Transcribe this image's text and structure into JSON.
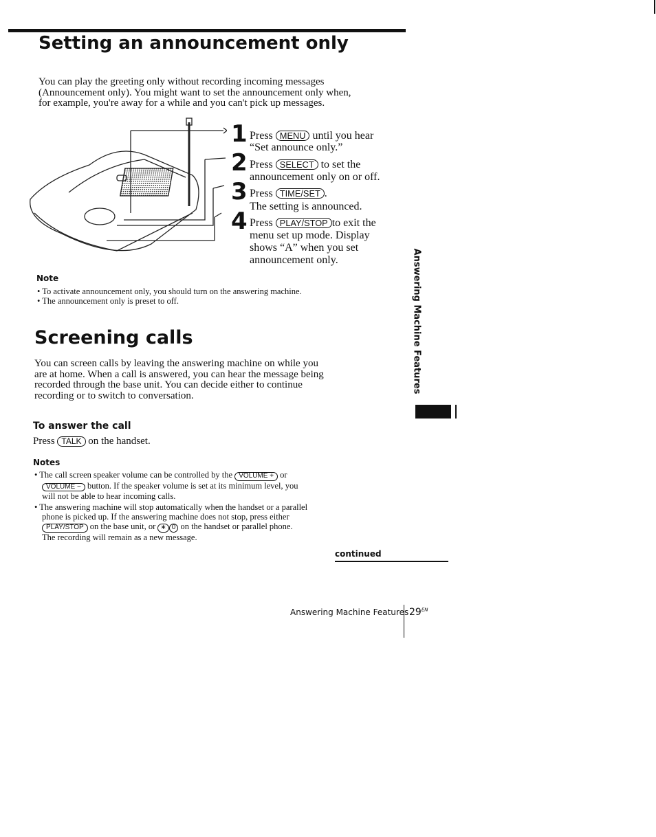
{
  "section1": {
    "title": "Setting an announcement only",
    "intro": [
      "You can play the greeting only without recording incoming messages",
      "(Announcement only). You might want to set the announcement only when,",
      "for example, you're away for a while and you can't pick up messages."
    ],
    "steps": [
      {
        "num": "1",
        "pre": "Press",
        "key": "MENU",
        "post": "until you hear",
        "lines": [
          "“Set announce only.”"
        ]
      },
      {
        "num": "2",
        "pre": "Press",
        "key": "SELECT",
        "post": "to set the",
        "lines": [
          "announcement only on or off."
        ]
      },
      {
        "num": "3",
        "pre": "Press",
        "key": "TIME/SET",
        "post": ".",
        "lines": [
          "The setting is announced."
        ]
      },
      {
        "num": "4",
        "pre": "Press",
        "key": "PLAY/STOP",
        "post": "to exit the",
        "lines": [
          "menu set up mode. Display",
          "shows “A” when you set",
          "announcement only."
        ]
      }
    ],
    "note_title": "Note",
    "notes": [
      "To activate announcement only, you should turn on the answering machine.",
      "The announcement only is preset to off."
    ]
  },
  "section2": {
    "title": "Screening calls",
    "intro": [
      "You can screen calls by leaving the answering machine on while you",
      "are at home. When a call is answered, you can hear the message being",
      "recorded through the base unit. You can decide either to continue",
      "recording or to switch to conversation."
    ],
    "sub_title": "To answer the call",
    "answer": {
      "pre": "Press",
      "key": "TALK",
      "post": "on the handset."
    },
    "notes_title": "Notes",
    "note1": {
      "a": "The call screen speaker volume can be controlled by the",
      "key1": "VOLUME +",
      "b": "or",
      "key2": "VOLUME −",
      "c": "button. If the speaker volume is set at its minimum level, you",
      "d": "will not be able to hear incoming calls."
    },
    "note2": {
      "a": "The answering machine will stop automatically when the handset or a parallel",
      "b": "phone is picked up. If the answering machine does not stop, press either",
      "key1": "PLAY/STOP",
      "c": "on the base unit, or",
      "key2": "∗",
      "key3": "0",
      "d": "on the handset or parallel phone.",
      "e": "The recording will remain as a new message."
    }
  },
  "continued": "continued",
  "side_tab": "Answering Machine Features",
  "footer": {
    "section": "Answering Machine Features",
    "page": "29",
    "suffix": "EN"
  }
}
